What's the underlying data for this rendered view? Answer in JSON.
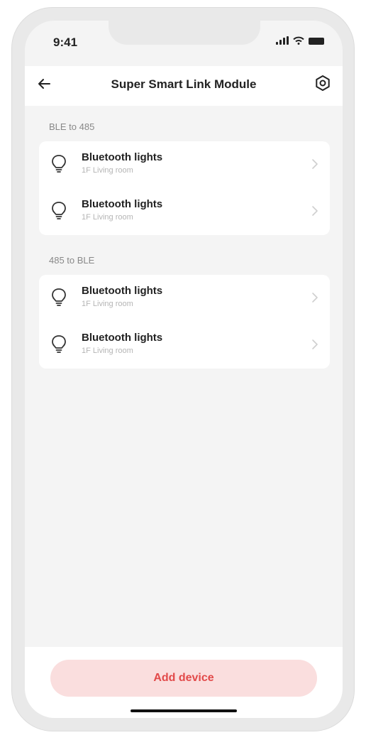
{
  "status_bar": {
    "time": "9:41",
    "icons": [
      "signal-icon",
      "wifi-icon",
      "battery-icon"
    ]
  },
  "header": {
    "title": "Super Smart Link Module",
    "back_icon": "back-arrow-icon",
    "settings_icon": "settings-icon"
  },
  "sections": [
    {
      "label": "BLE to 485",
      "devices": [
        {
          "name": "Bluetooth lights",
          "location": "1F Living room",
          "icon": "bulb-icon"
        },
        {
          "name": "Bluetooth lights",
          "location": "1F Living room",
          "icon": "bulb-icon"
        }
      ]
    },
    {
      "label": "485 to BLE",
      "devices": [
        {
          "name": "Bluetooth lights",
          "location": "1F Living room",
          "icon": "bulb-icon"
        },
        {
          "name": "Bluetooth lights",
          "location": "1F Living room",
          "icon": "bulb-icon"
        }
      ]
    }
  ],
  "footer": {
    "add_button_label": "Add device"
  },
  "colors": {
    "background": "#f4f4f4",
    "card": "#ffffff",
    "accent": "#e24a4a",
    "accent_bg": "#fadede"
  }
}
